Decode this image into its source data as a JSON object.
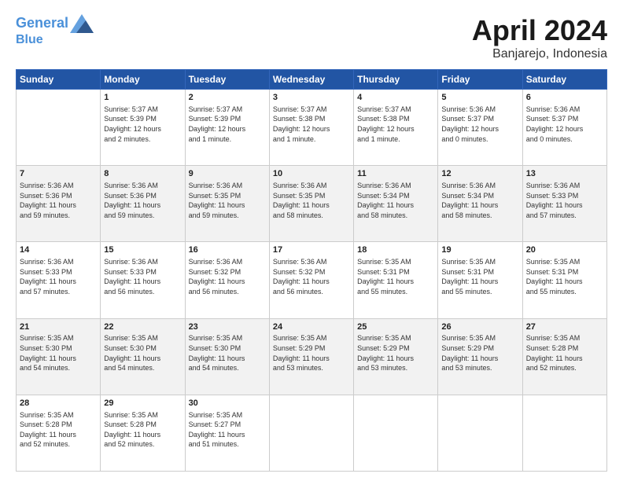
{
  "header": {
    "logo_line1": "General",
    "logo_line2": "Blue",
    "title": "April 2024",
    "subtitle": "Banjarejo, Indonesia"
  },
  "days_of_week": [
    "Sunday",
    "Monday",
    "Tuesday",
    "Wednesday",
    "Thursday",
    "Friday",
    "Saturday"
  ],
  "weeks": [
    [
      {
        "num": "",
        "info": ""
      },
      {
        "num": "1",
        "info": "Sunrise: 5:37 AM\nSunset: 5:39 PM\nDaylight: 12 hours\nand 2 minutes."
      },
      {
        "num": "2",
        "info": "Sunrise: 5:37 AM\nSunset: 5:39 PM\nDaylight: 12 hours\nand 1 minute."
      },
      {
        "num": "3",
        "info": "Sunrise: 5:37 AM\nSunset: 5:38 PM\nDaylight: 12 hours\nand 1 minute."
      },
      {
        "num": "4",
        "info": "Sunrise: 5:37 AM\nSunset: 5:38 PM\nDaylight: 12 hours\nand 1 minute."
      },
      {
        "num": "5",
        "info": "Sunrise: 5:36 AM\nSunset: 5:37 PM\nDaylight: 12 hours\nand 0 minutes."
      },
      {
        "num": "6",
        "info": "Sunrise: 5:36 AM\nSunset: 5:37 PM\nDaylight: 12 hours\nand 0 minutes."
      }
    ],
    [
      {
        "num": "7",
        "info": "Sunrise: 5:36 AM\nSunset: 5:36 PM\nDaylight: 11 hours\nand 59 minutes."
      },
      {
        "num": "8",
        "info": "Sunrise: 5:36 AM\nSunset: 5:36 PM\nDaylight: 11 hours\nand 59 minutes."
      },
      {
        "num": "9",
        "info": "Sunrise: 5:36 AM\nSunset: 5:35 PM\nDaylight: 11 hours\nand 59 minutes."
      },
      {
        "num": "10",
        "info": "Sunrise: 5:36 AM\nSunset: 5:35 PM\nDaylight: 11 hours\nand 58 minutes."
      },
      {
        "num": "11",
        "info": "Sunrise: 5:36 AM\nSunset: 5:34 PM\nDaylight: 11 hours\nand 58 minutes."
      },
      {
        "num": "12",
        "info": "Sunrise: 5:36 AM\nSunset: 5:34 PM\nDaylight: 11 hours\nand 58 minutes."
      },
      {
        "num": "13",
        "info": "Sunrise: 5:36 AM\nSunset: 5:33 PM\nDaylight: 11 hours\nand 57 minutes."
      }
    ],
    [
      {
        "num": "14",
        "info": "Sunrise: 5:36 AM\nSunset: 5:33 PM\nDaylight: 11 hours\nand 57 minutes."
      },
      {
        "num": "15",
        "info": "Sunrise: 5:36 AM\nSunset: 5:33 PM\nDaylight: 11 hours\nand 56 minutes."
      },
      {
        "num": "16",
        "info": "Sunrise: 5:36 AM\nSunset: 5:32 PM\nDaylight: 11 hours\nand 56 minutes."
      },
      {
        "num": "17",
        "info": "Sunrise: 5:36 AM\nSunset: 5:32 PM\nDaylight: 11 hours\nand 56 minutes."
      },
      {
        "num": "18",
        "info": "Sunrise: 5:35 AM\nSunset: 5:31 PM\nDaylight: 11 hours\nand 55 minutes."
      },
      {
        "num": "19",
        "info": "Sunrise: 5:35 AM\nSunset: 5:31 PM\nDaylight: 11 hours\nand 55 minutes."
      },
      {
        "num": "20",
        "info": "Sunrise: 5:35 AM\nSunset: 5:31 PM\nDaylight: 11 hours\nand 55 minutes."
      }
    ],
    [
      {
        "num": "21",
        "info": "Sunrise: 5:35 AM\nSunset: 5:30 PM\nDaylight: 11 hours\nand 54 minutes."
      },
      {
        "num": "22",
        "info": "Sunrise: 5:35 AM\nSunset: 5:30 PM\nDaylight: 11 hours\nand 54 minutes."
      },
      {
        "num": "23",
        "info": "Sunrise: 5:35 AM\nSunset: 5:30 PM\nDaylight: 11 hours\nand 54 minutes."
      },
      {
        "num": "24",
        "info": "Sunrise: 5:35 AM\nSunset: 5:29 PM\nDaylight: 11 hours\nand 53 minutes."
      },
      {
        "num": "25",
        "info": "Sunrise: 5:35 AM\nSunset: 5:29 PM\nDaylight: 11 hours\nand 53 minutes."
      },
      {
        "num": "26",
        "info": "Sunrise: 5:35 AM\nSunset: 5:29 PM\nDaylight: 11 hours\nand 53 minutes."
      },
      {
        "num": "27",
        "info": "Sunrise: 5:35 AM\nSunset: 5:28 PM\nDaylight: 11 hours\nand 52 minutes."
      }
    ],
    [
      {
        "num": "28",
        "info": "Sunrise: 5:35 AM\nSunset: 5:28 PM\nDaylight: 11 hours\nand 52 minutes."
      },
      {
        "num": "29",
        "info": "Sunrise: 5:35 AM\nSunset: 5:28 PM\nDaylight: 11 hours\nand 52 minutes."
      },
      {
        "num": "30",
        "info": "Sunrise: 5:35 AM\nSunset: 5:27 PM\nDaylight: 11 hours\nand 51 minutes."
      },
      {
        "num": "",
        "info": ""
      },
      {
        "num": "",
        "info": ""
      },
      {
        "num": "",
        "info": ""
      },
      {
        "num": "",
        "info": ""
      }
    ]
  ]
}
